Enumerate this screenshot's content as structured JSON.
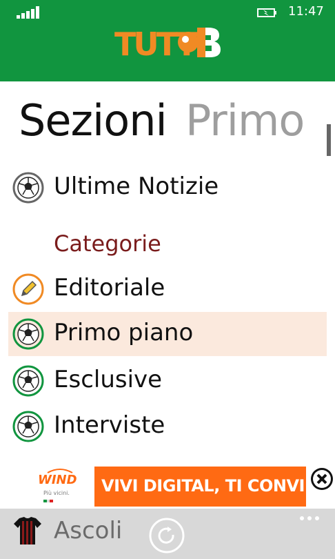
{
  "status": {
    "time": "11:47"
  },
  "header": {
    "logo_text": "TUTTO B"
  },
  "pivot": {
    "current": "Sezioni",
    "next": "Primo"
  },
  "menu": {
    "top_item": {
      "label": "Ultime Notizie",
      "icon": "soccer-ball-gray-icon"
    },
    "category_heading": "Categorie",
    "items": [
      {
        "label": "Editoriale",
        "icon": "pencil-icon",
        "selected": false
      },
      {
        "label": "Primo piano",
        "icon": "soccer-ball-icon",
        "selected": true
      },
      {
        "label": "Esclusive",
        "icon": "soccer-ball-icon",
        "selected": false
      },
      {
        "label": "Interviste",
        "icon": "soccer-ball-icon",
        "selected": false
      }
    ]
  },
  "ad": {
    "brand": "WIND",
    "sub": "Più vicini.",
    "text": "VIVI DIGITAL, TI CONVIENE!"
  },
  "appbar": {
    "team": "Ascoli"
  },
  "colors": {
    "header_green": "#11953f",
    "accent_orange": "#f08a24",
    "selected_bg": "#fbe9dd",
    "category_red": "#7a1c1c"
  }
}
